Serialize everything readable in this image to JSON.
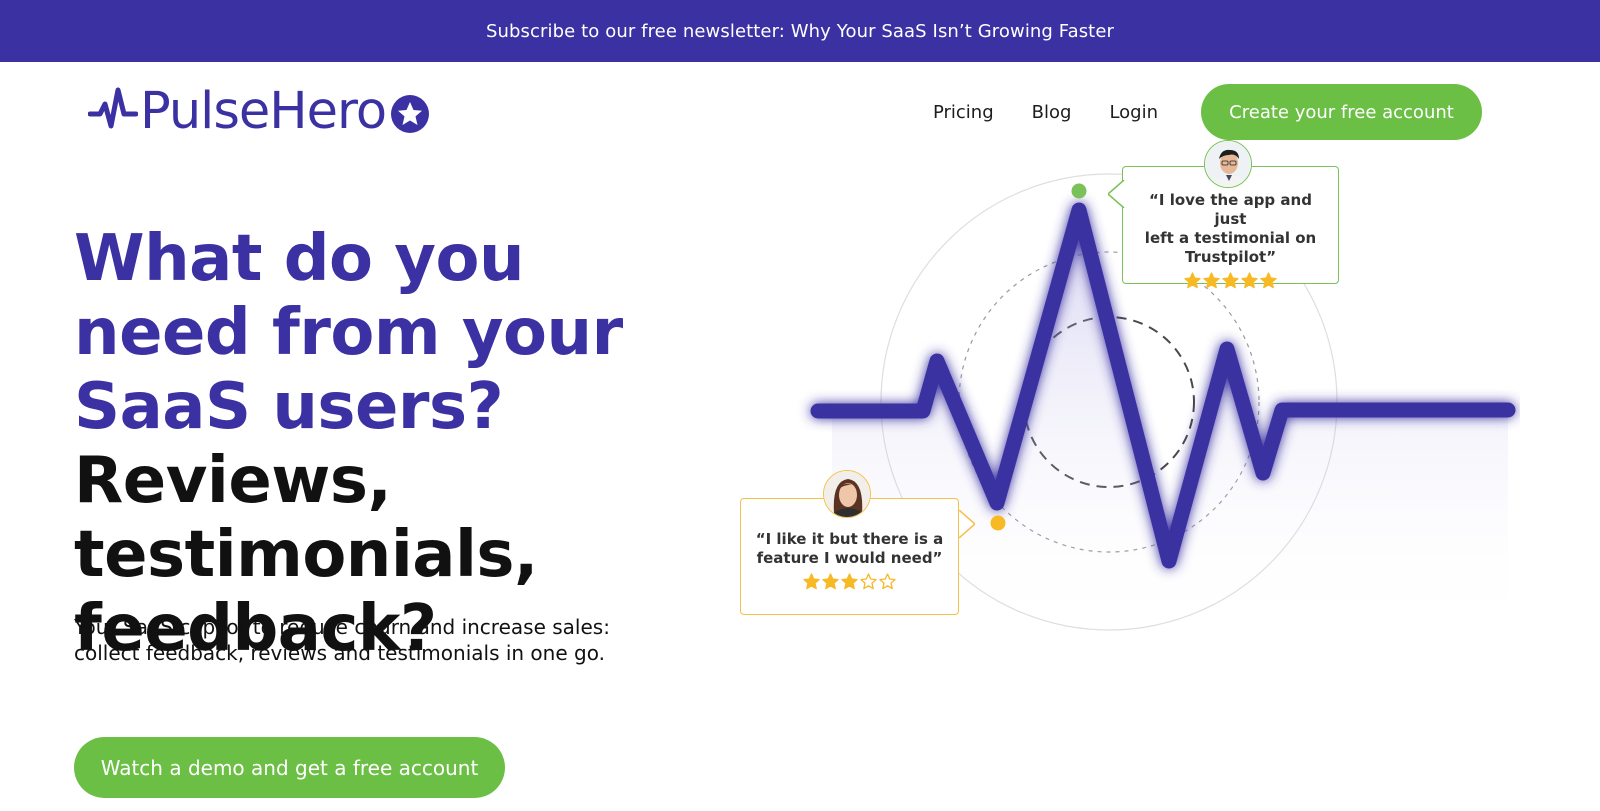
{
  "banner": {
    "text": "Subscribe to our free newsletter: Why Your SaaS Isn’t Growing Faster"
  },
  "logo": {
    "text": "PulseHero"
  },
  "nav": {
    "pricing": "Pricing",
    "blog": "Blog",
    "login": "Login",
    "create_account": "Create your free account"
  },
  "hero": {
    "title_accent_1": "What do you need from your SaaS users?",
    "title_dark": "Reviews, testimonials, feedback?",
    "subtitle_line_1": "Your SaaS copilot to reduce churn and increase sales:",
    "subtitle_line_2": "collect feedback, reviews and testimonials in one go.",
    "cta": "Watch a demo and get a free account"
  },
  "testimonials": {
    "positive": {
      "quote_line_1": "“I love the app and just",
      "quote_line_2": "left a testimonial on",
      "quote_line_3": "Trustpilot”",
      "rating": 5,
      "rating_max": 5
    },
    "neutral": {
      "quote_line_1": "“I like it but there is a",
      "quote_line_2": "feature I would need”",
      "rating": 3,
      "rating_max": 5
    }
  },
  "colors": {
    "brand": "#3b31a2",
    "cta": "#6cbf45",
    "positive": "#79c158",
    "neutral": "#f3c14c",
    "star": "#f7b924"
  },
  "icons": {
    "logo_pulse": "pulse-line-icon",
    "logo_star": "star-in-circle-icon",
    "rating_full": "star-filled-icon",
    "rating_empty": "star-outline-icon"
  }
}
